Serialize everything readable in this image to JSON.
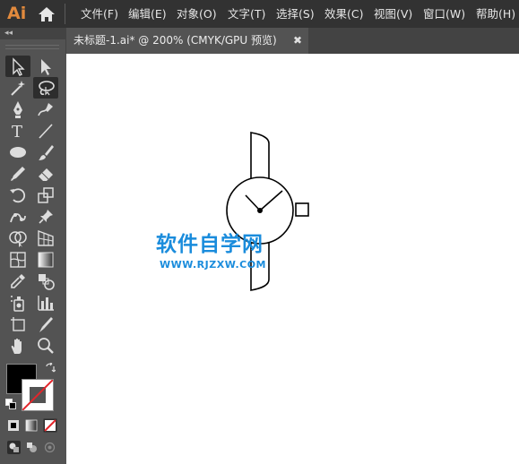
{
  "app": {
    "logo": "Ai"
  },
  "menu": {
    "items": [
      {
        "label": "文件(F)"
      },
      {
        "label": "编辑(E)"
      },
      {
        "label": "对象(O)"
      },
      {
        "label": "文字(T)"
      },
      {
        "label": "选择(S)"
      },
      {
        "label": "效果(C)"
      },
      {
        "label": "视图(V)"
      },
      {
        "label": "窗口(W)"
      },
      {
        "label": "帮助(H)"
      }
    ]
  },
  "tabstrip": {
    "collapse_glyph": "◂◂"
  },
  "document_tab": {
    "title": "未标题-1.ai* @ 200% (CMYK/GPU 预览)",
    "close": "✖"
  },
  "toolbar": {
    "tools": [
      "selection-tool",
      "direct-selection-tool",
      "magic-wand-tool",
      "lasso-tool",
      "pen-tool",
      "curvature-tool",
      "type-tool",
      "line-segment-tool",
      "ellipse-tool",
      "paintbrush-tool",
      "pencil-tool",
      "eraser-tool",
      "rotate-tool",
      "scale-tool",
      "puppet-warp-tool",
      "pin-tool",
      "shape-builder-tool",
      "perspective-grid-tool",
      "mesh-tool",
      "gradient-tool",
      "eyedropper-tool",
      "blend-tool",
      "symbol-sprayer-tool",
      "column-graph-tool",
      "artboard-tool",
      "slice-tool",
      "hand-tool",
      "zoom-tool"
    ],
    "fill_color": "#000000",
    "stroke_color": "none"
  },
  "canvas": {
    "watermark": {
      "title": "软件自学网",
      "url": "WWW.RJZXW.COM",
      "color": "#1a8cdc"
    }
  }
}
